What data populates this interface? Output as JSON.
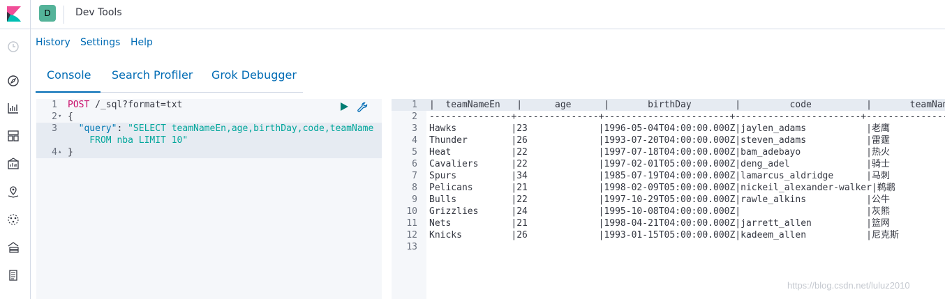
{
  "header": {
    "space_initial": "D",
    "app_title": "Dev Tools"
  },
  "sidenav": {
    "items": [
      "clock-icon",
      "discover-icon",
      "visualize-icon",
      "dashboard-icon",
      "canvas-icon",
      "maps-icon",
      "ml-icon",
      "infrastructure-icon",
      "logs-icon"
    ]
  },
  "top_menu": {
    "history": "History",
    "settings": "Settings",
    "help": "Help"
  },
  "tabs": [
    {
      "label": "Console",
      "active": true
    },
    {
      "label": "Search Profiler",
      "active": false
    },
    {
      "label": "Grok Debugger",
      "active": false
    }
  ],
  "editor": {
    "line_numbers": [
      "1",
      "2",
      "3",
      "",
      "4"
    ],
    "fold_markers": [
      "",
      "▾",
      "",
      "",
      "▴"
    ],
    "line1_method": "POST",
    "line1_url": " /_sql?format=txt",
    "line2": "{",
    "line3_indent": "  ",
    "line3_key": "\"query\"",
    "line3_colon": ": ",
    "line3_value": "\"SELECT teamNameEn,age,birthDay,code,teamName",
    "line3b_value": "    FROM nba LIMIT 10\"",
    "line4": "}"
  },
  "output": {
    "line_numbers": [
      "1",
      "2",
      "3",
      "4",
      "5",
      "6",
      "7",
      "8",
      "9",
      "10",
      "11",
      "12",
      "13"
    ],
    "lines": [
      "|  teamNameEn   |      age      |       birthDay        |         code          |       teamName",
      "---------------+---------------+-----------------------+-----------------------+----------------",
      "Hawks          |23             |1996-05-04T04:00:00.000Z|jaylen_adams           |老鹰",
      "Thunder        |26             |1993-07-20T04:00:00.000Z|steven_adams           |雷霆",
      "Heat           |22             |1997-07-18T04:00:00.000Z|bam_adebayo            |热火",
      "Cavaliers      |22             |1997-02-01T05:00:00.000Z|deng_adel              |骑士",
      "Spurs          |34             |1985-07-19T04:00:00.000Z|lamarcus_aldridge      |马刺",
      "Pelicans       |21             |1998-02-09T05:00:00.000Z|nickeil_alexander-walker|鹈鹕",
      "Bulls          |22             |1997-10-29T05:00:00.000Z|rawle_alkins           |公牛",
      "Grizzlies      |24             |1995-10-08T04:00:00.000Z|                       |灰熊",
      "Nets           |21             |1998-04-21T04:00:00.000Z|jarrett_allen          |篮网",
      "Knicks         |26             |1993-01-15T05:00:00.000Z|kadeem_allen           |尼克斯",
      ""
    ]
  },
  "watermark": "https://blog.csdn.net/luluz2010",
  "colors": {
    "link": "#006bb4",
    "avatar": "#54b399",
    "editor_bg": "#f5f7fa",
    "active_line": "#e6ebf2",
    "method": "#c80a68",
    "string": "#00a69b",
    "key": "#0078b4",
    "run": "#017d73"
  }
}
